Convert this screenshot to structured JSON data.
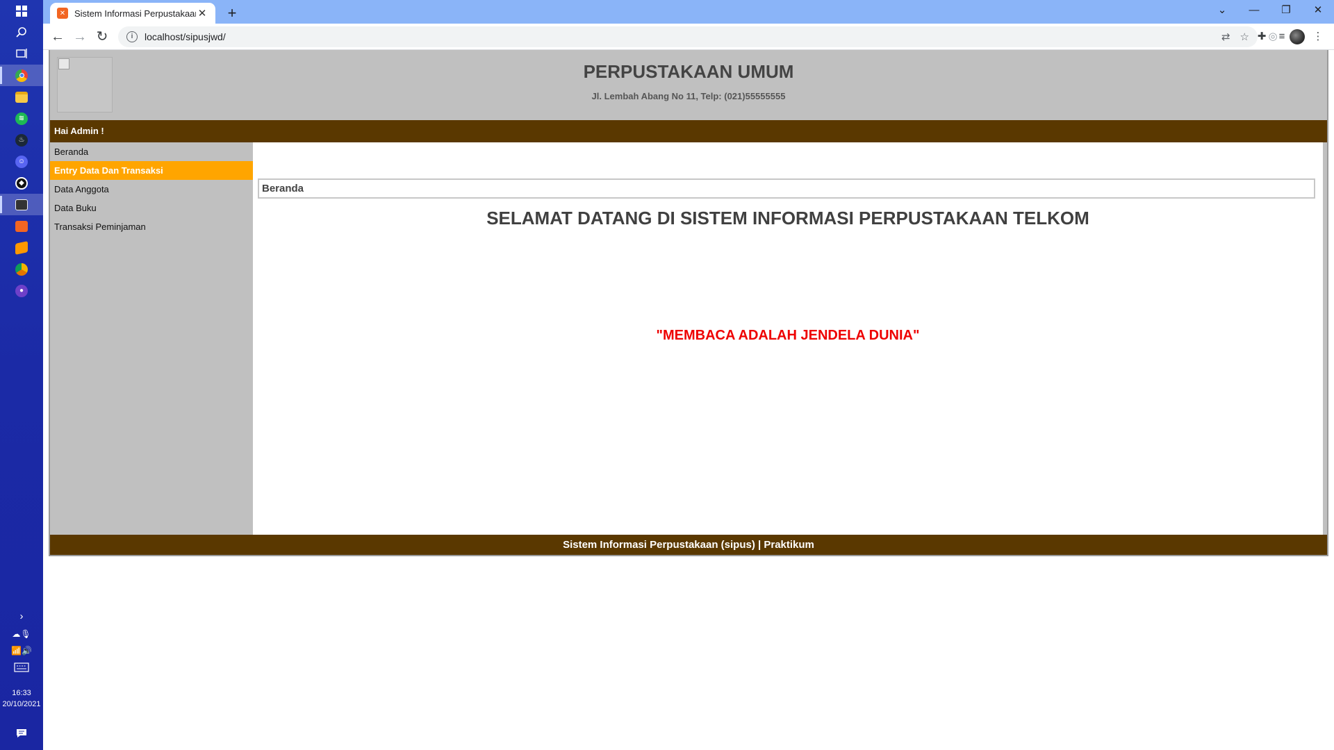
{
  "taskbar": {
    "clock_time": "16:33",
    "clock_date": "20/10/2021",
    "apps": [
      "chrome-icon",
      "file-explorer-icon",
      "spotify-icon",
      "steam-icon",
      "discord-icon",
      "vpn-icon",
      "clapperboard-icon",
      "xampp-icon",
      "sublime-text-icon",
      "chrome-canary-icon",
      "github-desktop-icon"
    ]
  },
  "browser": {
    "tab_title": "Sistem Informasi Perpustakaan",
    "url": "localhost/sipusjwd/"
  },
  "site": {
    "title": "PERPUSTAKAAN UMUM",
    "address": "Jl. Lembah Abang No 11, Telp: (021)55555555",
    "greeting": "Hai Admin !",
    "menu": [
      {
        "label": "Beranda"
      },
      {
        "label": "Entry Data Dan Transaksi"
      },
      {
        "label": "Data Anggota"
      },
      {
        "label": "Data Buku"
      },
      {
        "label": "Transaksi Peminjaman"
      }
    ],
    "active_menu": "Entry Data Dan Transaksi",
    "breadcrumb": "Beranda",
    "welcome": "SELAMAT DATANG DI SISTEM INFORMASI PERPUSTAKAAN TELKOM",
    "motto": "\"MEMBACA ADALAH JENDELA DUNIA\"",
    "footer": "Sistem Informasi Perpustakaan (sipus) | Praktikum"
  },
  "colors": {
    "brown_bar": "#5a3800",
    "active_menu": "#ffa500",
    "motto_red": "#ee0000",
    "panel_gray": "#c0c0c0"
  }
}
